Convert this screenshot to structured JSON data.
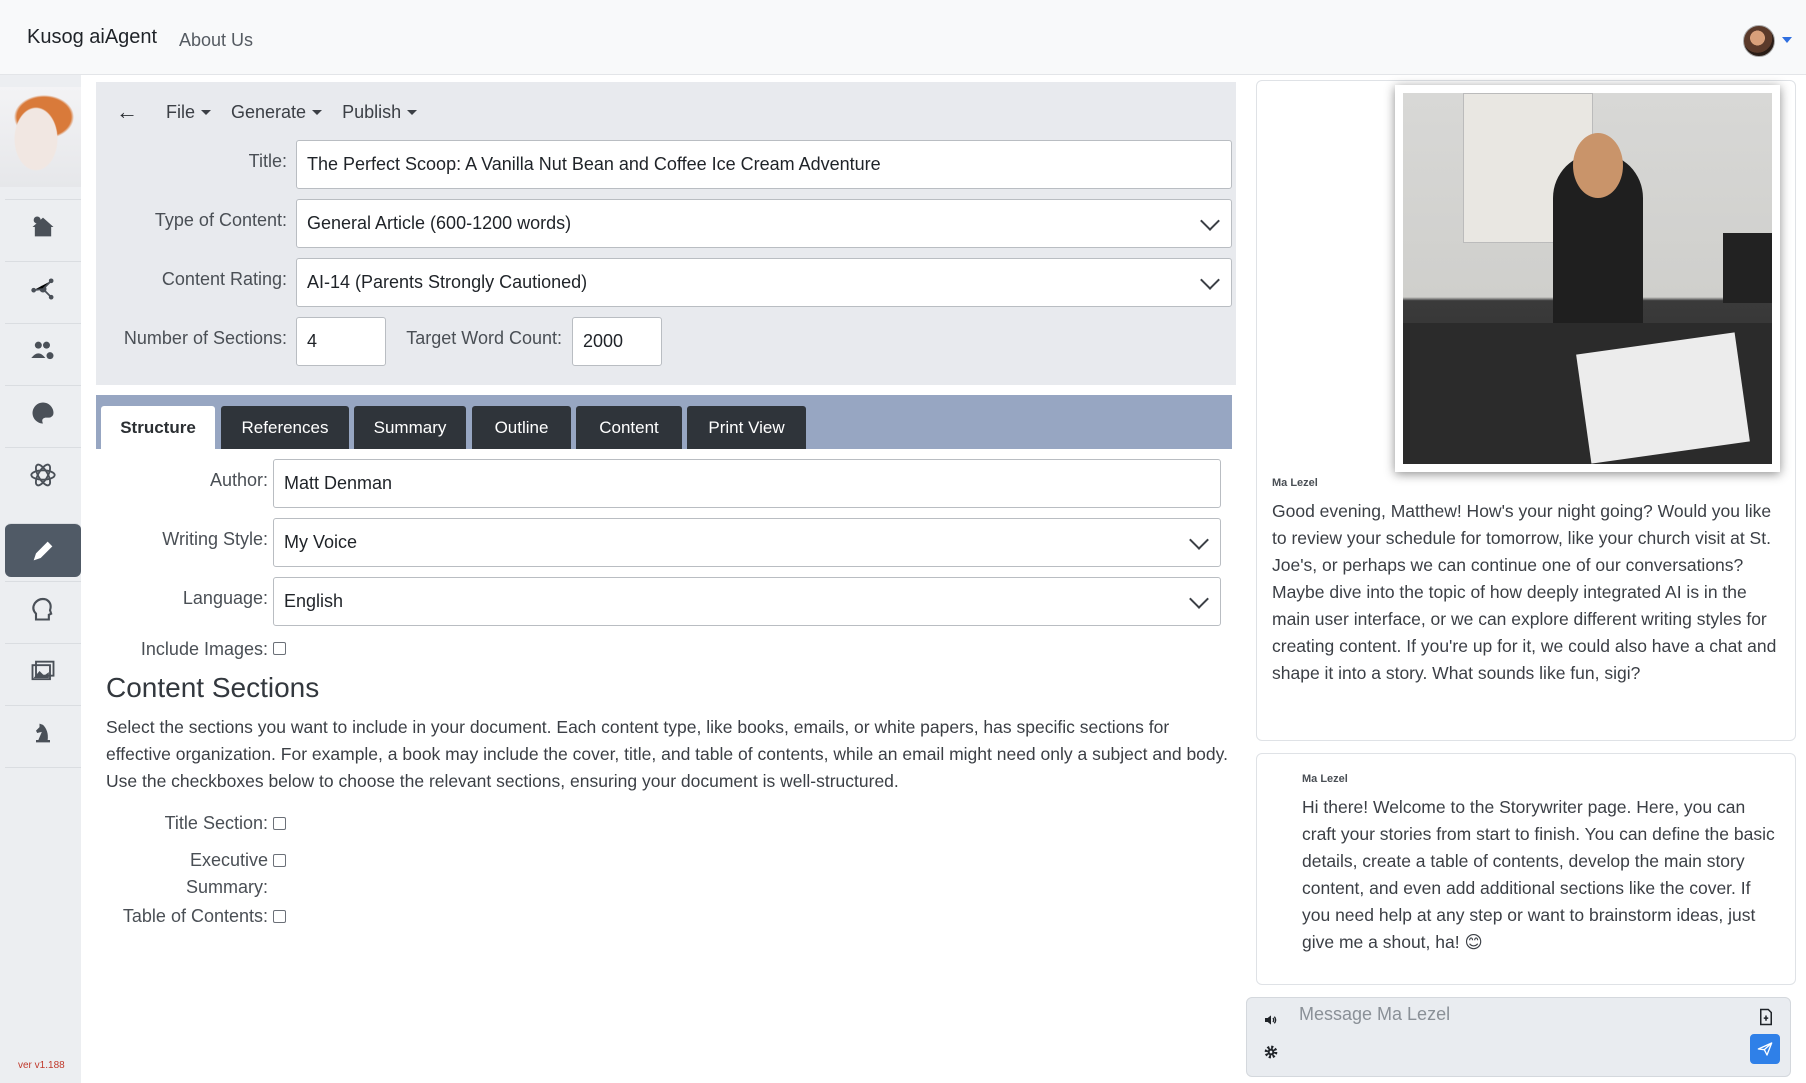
{
  "navbar": {
    "brand": "Kusog aiAgent",
    "about": "About Us"
  },
  "sidebar": {
    "version": "ver v1.188",
    "items": [
      {
        "icon": "home-gear-icon"
      },
      {
        "icon": "network-icon"
      },
      {
        "icon": "users-gear-icon"
      },
      {
        "icon": "palette-icon"
      },
      {
        "icon": "atom-icon"
      },
      {
        "icon": "pen-icon"
      },
      {
        "icon": "head-brain-icon"
      },
      {
        "icon": "images-icon"
      },
      {
        "icon": "chess-knight-icon"
      }
    ]
  },
  "menu": {
    "file": "File",
    "generate": "Generate",
    "publish": "Publish"
  },
  "form": {
    "title_label": "Title:",
    "title_value": "The Perfect Scoop: A Vanilla Nut Bean and Coffee Ice Cream Adventure",
    "type_label": "Type of Content:",
    "type_value": "General Article (600-1200 words)",
    "rating_label": "Content Rating:",
    "rating_value": "AI-14 (Parents Strongly Cautioned)",
    "sections_label": "Number of Sections:",
    "sections_value": "4",
    "wordcount_label": "Target Word Count:",
    "wordcount_value": "2000"
  },
  "tabs": [
    "Structure",
    "References",
    "Summary",
    "Outline",
    "Content",
    "Print View"
  ],
  "structure": {
    "author_label": "Author:",
    "author_value": "Matt Denman",
    "style_label": "Writing Style:",
    "style_value": "My Voice",
    "language_label": "Language:",
    "language_value": "English",
    "images_label": "Include Images:",
    "heading": "Content Sections",
    "description": "Select the sections you want to include in your document. Each content type, like books, emails, or white papers, has specific sections for effective organization. For example, a book may include the cover, title, and table of contents, while an email might need only a subject and body. Use the checkboxes below to choose the relevant sections, ensuring your document is well-structured.",
    "title_section_label": "Title Section:",
    "exec_summary_label_1": "Executive",
    "exec_summary_label_2": "Summary:",
    "toc_label": "Table of Contents:"
  },
  "chat": {
    "messages": [
      {
        "speaker": "Ma Lezel",
        "text": "Good evening, Matthew! How's your night going? Would you like to review your schedule for tomorrow, like your church visit at St. Joe's, or perhaps we can continue one of our conversations? Maybe dive into the topic of how deeply integrated AI is in the main user interface, or we can explore different writing styles for creating content. If you're up for it, we could also have a chat and shape it into a story. What sounds like fun, sigi?"
      },
      {
        "speaker": "Ma Lezel",
        "text": "Hi there! Welcome to the Storywriter page. Here, you can craft your stories from start to finish. You can define the basic details, create a table of contents, develop the main story content, and even add additional sections like the cover. If you need help at any step or want to brainstorm ideas, just give me a shout, ha! 😊"
      }
    ],
    "placeholder": "Message Ma Lezel"
  }
}
